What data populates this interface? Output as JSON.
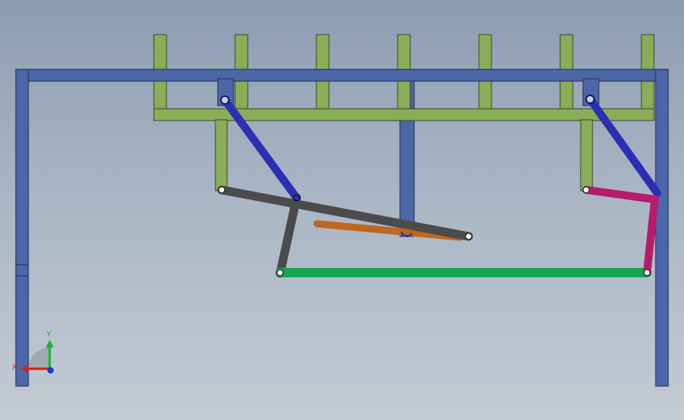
{
  "triad": {
    "x_label": "X",
    "y_label": "Y"
  },
  "colors": {
    "frame": "#4b67a8",
    "frame_edge": "#1f2f55",
    "rack": "#8aad58",
    "rack_edge": "#3b4a25",
    "link_blue": "#2b2fb5",
    "link_gray": "#4b4b4b",
    "link_orange": "#c0671f",
    "link_green": "#13a553",
    "link_magenta": "#b51d6c",
    "axis_x": "#d21f1f",
    "axis_y": "#17b52d",
    "axis_z": "#1d36d6"
  }
}
